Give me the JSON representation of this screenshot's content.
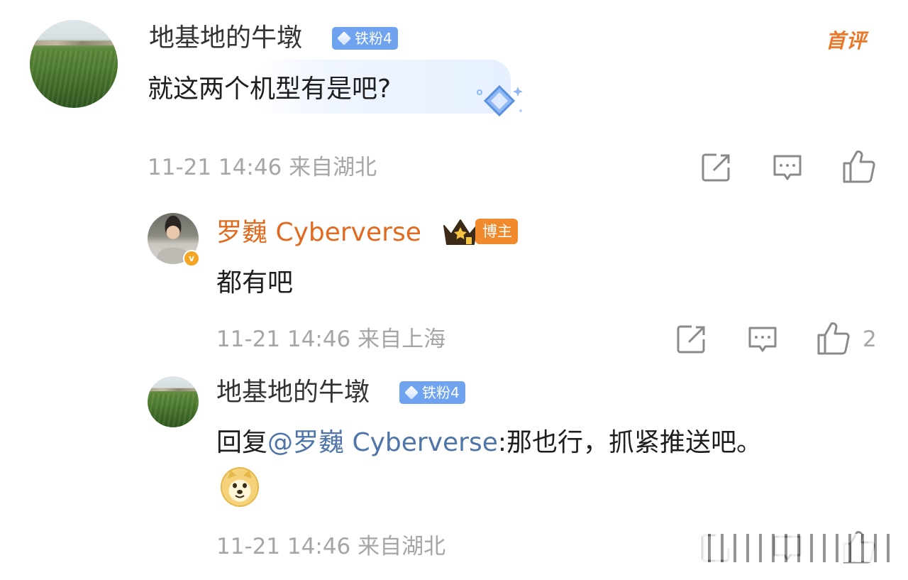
{
  "comments": [
    {
      "username": "地基地的牛墩",
      "fan_badge": "铁粉4",
      "first_comment_badge": "首评",
      "text": "就这两个机型有是吧?",
      "meta": "11-21 14:46  来自湖北"
    },
    {
      "username": "罗巍 Cyberverse",
      "host_badge": "博主",
      "text": "都有吧",
      "meta": "11-21 14:46  来自上海",
      "like_count": "2"
    },
    {
      "username": "地基地的牛墩",
      "fan_badge": "铁粉4",
      "reply_prefix": "回复",
      "mention": "@罗巍 Cyberverse",
      "text": ":那也行，抓紧推送吧。",
      "meta": "11-21 14:46  来自湖北"
    }
  ],
  "icons": {
    "share": "share-icon",
    "comment": "comment-icon",
    "like": "like-icon",
    "verified": "verified-badge",
    "emoji": "doge-emoji"
  },
  "colors": {
    "vip_name": "#e06a1f",
    "mention": "#4e74a8",
    "meta": "#a6a6a6",
    "fan_badge": "#6fa3f0",
    "host_badge": "#f08a2c"
  }
}
